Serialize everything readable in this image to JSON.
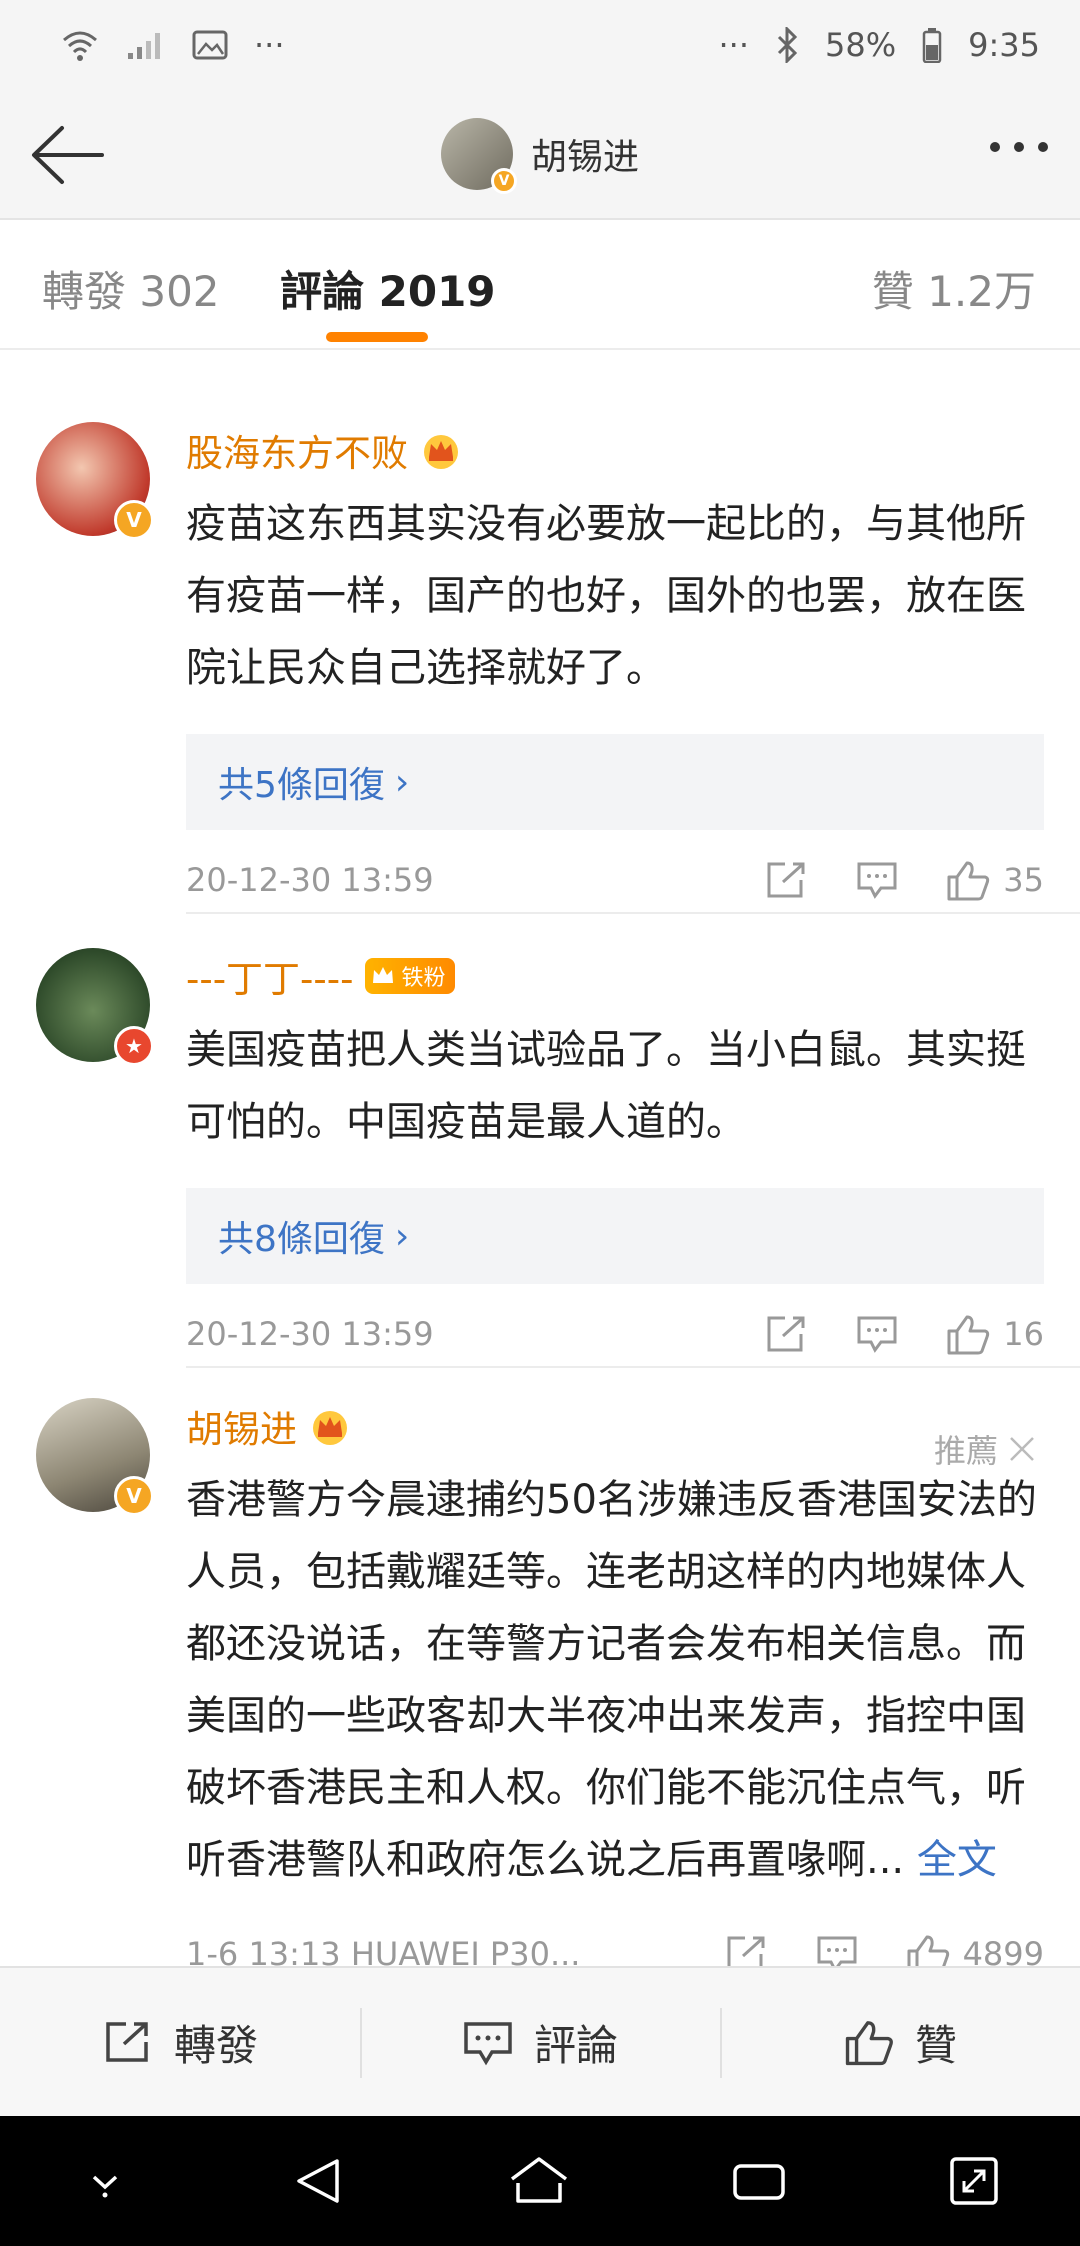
{
  "status_bar": {
    "battery": "58%",
    "time": "9:35",
    "left_dots": "···",
    "right_dots": "···"
  },
  "header": {
    "title": "胡锡进"
  },
  "tabs": [
    {
      "label": "轉發 302"
    },
    {
      "label": "評論 2019"
    },
    {
      "label": "贊 1.2万"
    }
  ],
  "comments": [
    {
      "username": "股海东方不败",
      "text": "疫苗这东西其实没有必要放一起比的，与其他所有疫苗一样，国产的也好，国外的也罢，放在医院让民众自己选择就好了。",
      "replies": "共5條回復",
      "time": "20-12-30 13:59",
      "likes": "35"
    },
    {
      "username": "---丁丁----",
      "fan_badge": "铁粉",
      "text": "美国疫苗把人类当试验品了。当小白鼠。其实挺可怕的。中国疫苗是最人道的。",
      "replies": "共8條回復",
      "time": "20-12-30 13:59",
      "likes": "16"
    },
    {
      "username": "胡锡进",
      "recommend": "推薦",
      "text": "香港警方今晨逮捕约50名涉嫌违反香港国安法的人员，包括戴耀廷等。连老胡这样的内地媒体人都还没说话，在等警方记者会发布相关信息。而美国的一些政客却大半夜冲出来发声，指控中国破坏香港民主和人权。你们能不能沉住点气，听听香港警队和政府怎么说之后再置喙啊...",
      "fulltext": "全文",
      "time": "1-6 13:13  HUAWEI P30...",
      "likes": "4899"
    }
  ],
  "bottom_bar": {
    "repost": "轉發",
    "comment": "評論",
    "like": "贊"
  },
  "colors": {
    "accent": "#ff8200",
    "username": "#e07b00",
    "link": "#3d74c5"
  }
}
